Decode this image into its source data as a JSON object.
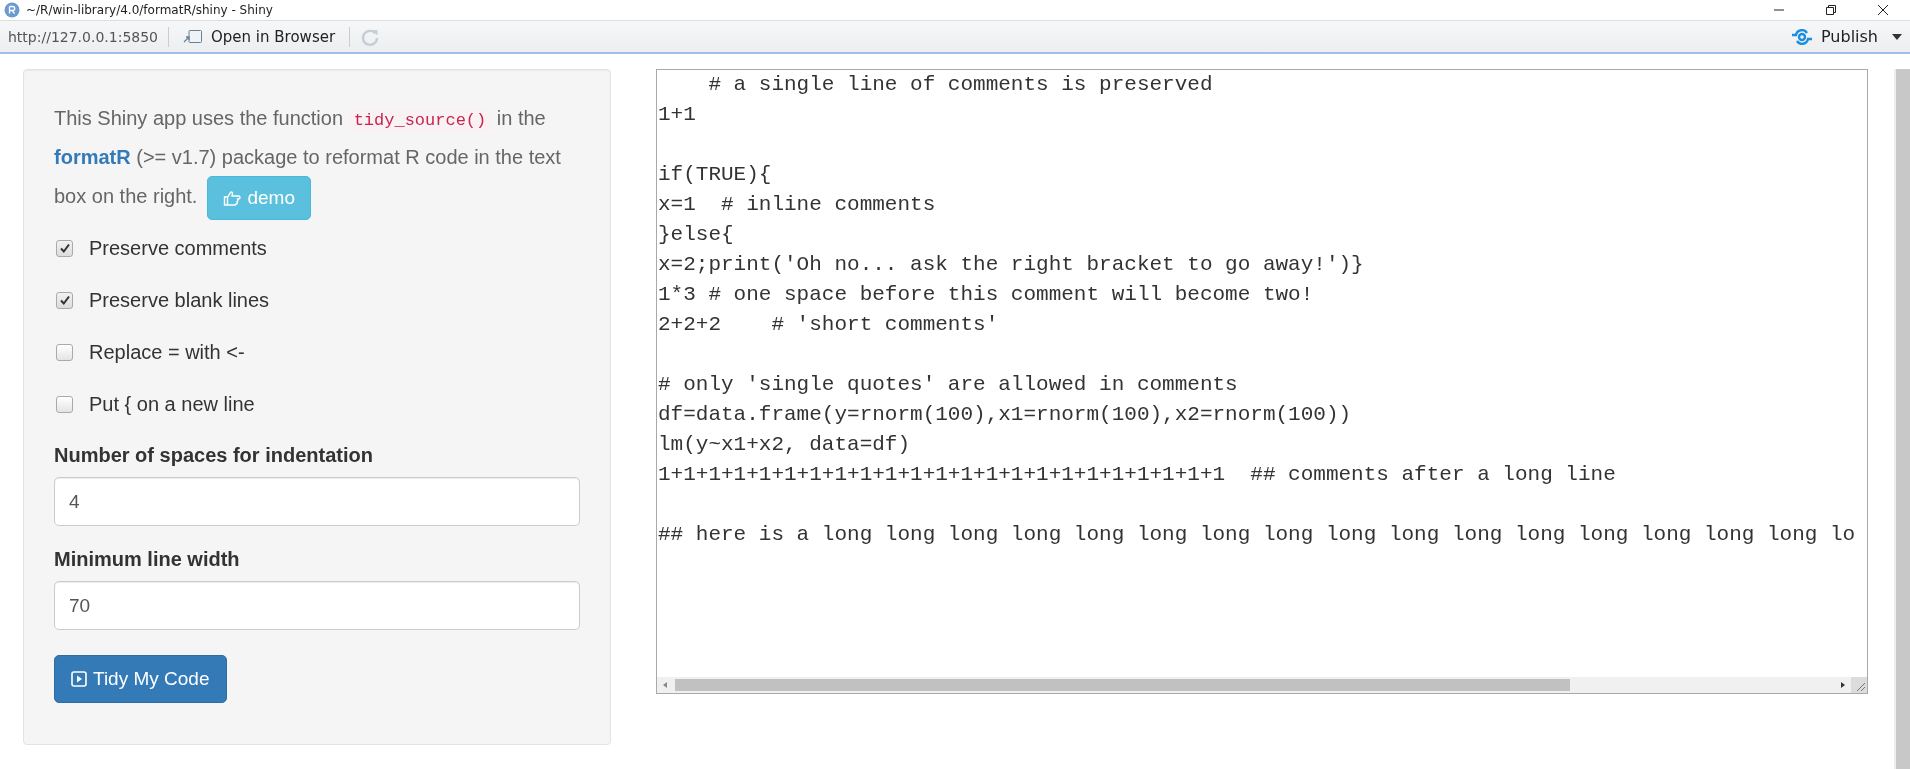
{
  "window": {
    "title": "~/R/win-library/4.0/formatR/shiny - Shiny"
  },
  "toolbar": {
    "url": "http://127.0.0.1:5850",
    "open_button": "Open in Browser",
    "publish_button": "Publish"
  },
  "sidebar": {
    "intro": {
      "before": "This Shiny app uses the function",
      "code": "tidy_source()",
      "middle": "in the",
      "link": "formatR",
      "after": "(>= v1.7) package to reformat R code in the text box on the right."
    },
    "demo_button": "demo",
    "checkboxes": [
      {
        "label": "Preserve comments",
        "checked": true
      },
      {
        "label": "Preserve blank lines",
        "checked": true
      },
      {
        "label": "Replace = with <-",
        "checked": false
      },
      {
        "label": "Put { on a new line",
        "checked": false
      }
    ],
    "fields": [
      {
        "label": "Number of spaces for indentation",
        "value": "4"
      },
      {
        "label": "Minimum line width",
        "value": "70"
      }
    ],
    "tidy_button": "Tidy My Code"
  },
  "editor": {
    "code": "    # a single line of comments is preserved\n1+1\n\nif(TRUE){\nx=1  # inline comments\n}else{\nx=2;print('Oh no... ask the right bracket to go away!')}\n1*3 # one space before this comment will become two!\n2+2+2    # 'short comments'\n\n# only 'single quotes' are allowed in comments\ndf=data.frame(y=rnorm(100),x1=rnorm(100),x2=rnorm(100))\nlm(y~x1+x2, data=df)\n1+1+1+1+1+1+1+1+1+1+1+1+1+1+1+1+1+1+1+1+1+1+1  ## comments after a long line\n\n## here is a long long long long long long long long long long long long long long long long lo"
  }
}
